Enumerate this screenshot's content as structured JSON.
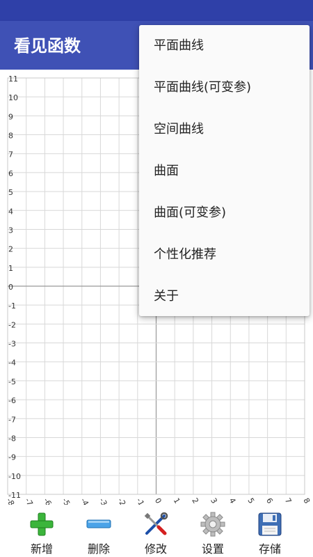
{
  "app": {
    "title": "看见函数"
  },
  "graph": {
    "x_range": [
      -8,
      8
    ],
    "y_range": [
      -11,
      11
    ],
    "x_ticks": [
      "-8",
      "-7",
      "-6",
      "-5",
      "-4",
      "-3",
      "-2",
      "-1",
      "0",
      "1",
      "2",
      "3",
      "4",
      "5",
      "6",
      "7",
      "8"
    ],
    "y_ticks": [
      "11",
      "10",
      "9",
      "8",
      "7",
      "6",
      "5",
      "4",
      "3",
      "2",
      "1",
      "0",
      "-1",
      "-2",
      "-3",
      "-4",
      "-5",
      "-6",
      "-7",
      "-8",
      "-9",
      "-10",
      "-11"
    ],
    "grid": true
  },
  "menu": {
    "items": [
      {
        "label": "平面曲线"
      },
      {
        "label": "平面曲线(可变参)"
      },
      {
        "label": "空间曲线"
      },
      {
        "label": "曲面"
      },
      {
        "label": "曲面(可变参)"
      },
      {
        "label": "个性化推荐"
      },
      {
        "label": "关于"
      }
    ]
  },
  "toolbar": {
    "items": [
      {
        "label": "新增",
        "icon": "green-plus-icon"
      },
      {
        "label": "删除",
        "icon": "blue-minus-icon"
      },
      {
        "label": "修改",
        "icon": "tools-icon"
      },
      {
        "label": "设置",
        "icon": "gear-icon"
      },
      {
        "label": "存储",
        "icon": "floppy-disk-icon"
      }
    ]
  },
  "colors": {
    "status_bar": "#2f40a8",
    "app_bar": "#3f51b5",
    "grid": "#d8d8d8",
    "axis": "#999999"
  }
}
